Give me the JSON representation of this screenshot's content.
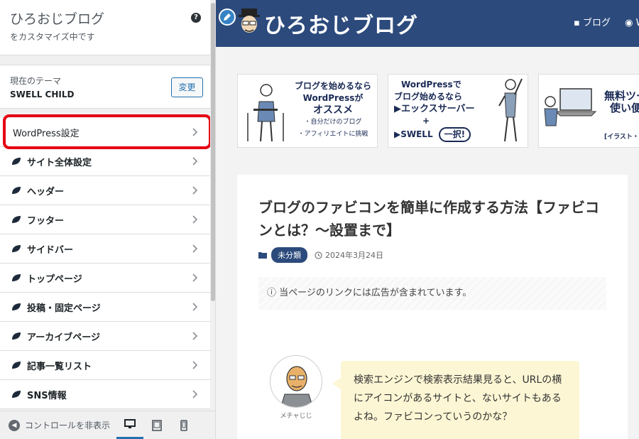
{
  "customizer": {
    "site_title": "ひろおじブログ",
    "subtitle": "をカスタマイズ中です",
    "help": "?",
    "theme_label": "現在のテーマ",
    "theme_name": "SWELL CHILD",
    "change_button": "変更",
    "menu": [
      {
        "label": "WordPress設定"
      },
      {
        "label": "サイト全体設定"
      },
      {
        "label": "ヘッダー"
      },
      {
        "label": "フッター"
      },
      {
        "label": "サイドバー"
      },
      {
        "label": "トップページ"
      },
      {
        "label": "投稿・固定ページ"
      },
      {
        "label": "アーカイブページ"
      },
      {
        "label": "記事一覧リスト"
      },
      {
        "label": "SNS情報"
      }
    ],
    "collapse_label": "コントロールを非表示",
    "accent_color": "#2271b1",
    "highlight_color": "#e50012"
  },
  "preview": {
    "logo_text": "ひろおじブログ",
    "nav": [
      "ブログ",
      "W"
    ],
    "banners": [
      {
        "lines": [
          "ブログを始めるなら",
          "WordPressが",
          "オススメ",
          "・自分だけのブログ",
          "・アフィリエイトに挑戦"
        ]
      },
      {
        "lines": [
          "WordPressで",
          "ブログ始めるなら",
          "▶エックスサーバー",
          "+",
          "▶SWELL",
          "一択!"
        ]
      },
      {
        "lines": [
          "無料ツー",
          "使い便",
          "[イラスト・写真・ツー"
        ]
      }
    ],
    "post_title": "ブログのファビコンを簡単に作成する方法【ファビコンとは？～設置まで】",
    "category": "未分類",
    "date": "2024年3月24日",
    "notice": "当ページのリンクには広告が含まれています。",
    "avatar_name": "メチャじじ",
    "bubble_text": "検索エンジンで検索表示結果見ると、URLの横にアイコンがあるサイトと、ないサイトもあるよね。ファビコンっていうのかな？",
    "header_color": "#2c4a7c"
  }
}
